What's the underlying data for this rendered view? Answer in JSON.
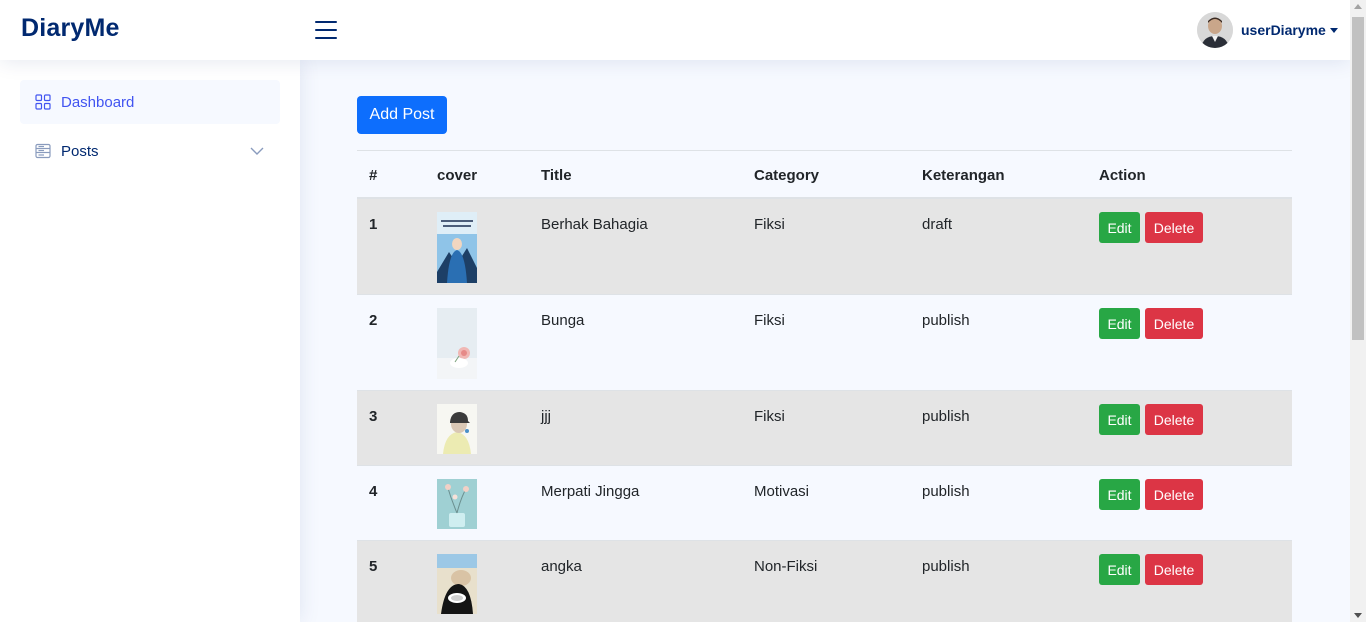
{
  "header": {
    "logo": "DiaryMe",
    "username": "userDiaryme"
  },
  "sidebar": {
    "items": [
      {
        "label": "Dashboard",
        "icon": "grid-icon",
        "active": true
      },
      {
        "label": "Posts",
        "icon": "layout-text-icon",
        "active": false
      }
    ]
  },
  "main": {
    "add_button": "Add Post",
    "table": {
      "columns": [
        "#",
        "cover",
        "Title",
        "Category",
        "Keterangan",
        "Action"
      ],
      "rows": [
        {
          "num": "1",
          "title": "Berhak Bahagia",
          "category": "Fiksi",
          "keterangan": "draft",
          "edit": "Edit",
          "delete": "Delete"
        },
        {
          "num": "2",
          "title": "Bunga",
          "category": "Fiksi",
          "keterangan": "publish",
          "edit": "Edit",
          "delete": "Delete"
        },
        {
          "num": "3",
          "title": "jjj",
          "category": "Fiksi",
          "keterangan": "publish",
          "edit": "Edit",
          "delete": "Delete"
        },
        {
          "num": "4",
          "title": "Merpati Jingga",
          "category": "Motivasi",
          "keterangan": "publish",
          "edit": "Edit",
          "delete": "Delete"
        },
        {
          "num": "5",
          "title": "angka",
          "category": "Non-Fiksi",
          "keterangan": "publish",
          "edit": "Edit",
          "delete": "Delete"
        }
      ]
    }
  },
  "colors": {
    "brand": "#012970",
    "primary": "#0d6efd",
    "success": "#28a745",
    "danger": "#dc3545",
    "active_nav": "#4154f1"
  }
}
